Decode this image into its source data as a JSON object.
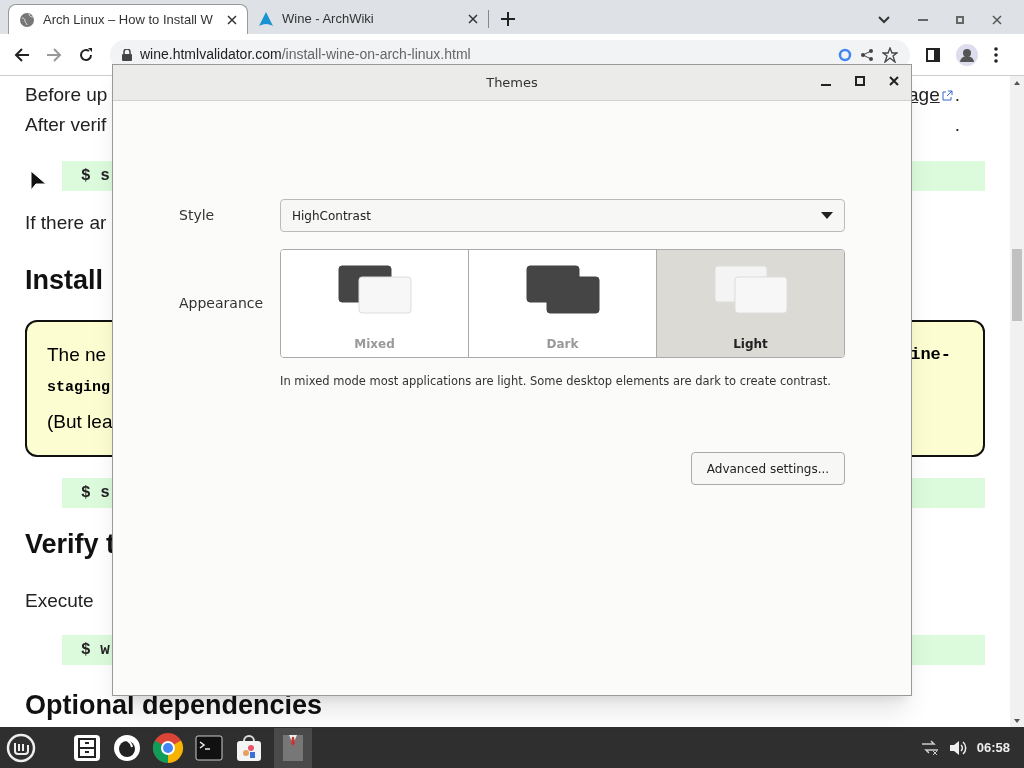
{
  "browser": {
    "tabs": [
      {
        "title": "Arch Linux – How to Install W",
        "selected": true,
        "kind": "globe"
      },
      {
        "title": "Wine - ArchWiki",
        "selected": false,
        "kind": "arch"
      }
    ],
    "url": {
      "host": "wine.htmlvalidator.com",
      "path": "/install-wine-on-arch-linux.html"
    }
  },
  "page": {
    "blocks": [
      {
        "kind": "text",
        "left": "Before up",
        "link": "age",
        "right": "."
      },
      {
        "kind": "text",
        "left": "After verif",
        "right": "."
      },
      {
        "kind": "code",
        "left": "$ s"
      },
      {
        "kind": "text",
        "left": "If there ar"
      },
      {
        "kind": "heading",
        "left": "Install"
      },
      {
        "kind": "note",
        "lines": [
          {
            "left": "The ne",
            "right": "ine-"
          },
          {
            "left": "staging",
            "mono": true
          },
          {
            "left": "(But lea"
          }
        ]
      },
      {
        "kind": "code",
        "left": "$ s"
      },
      {
        "kind": "heading",
        "left": "Verify t"
      },
      {
        "kind": "text",
        "left": "Execute"
      },
      {
        "kind": "code",
        "left": "$ w"
      },
      {
        "kind": "heading",
        "left": "Optional dependencies"
      }
    ]
  },
  "dialog": {
    "title": "Themes",
    "style": {
      "label": "Style",
      "value": "HighContrast"
    },
    "appearance": {
      "label": "Appearance",
      "options": [
        {
          "label": "Mixed",
          "kind": "mixed",
          "selected": false
        },
        {
          "label": "Dark",
          "kind": "dark",
          "selected": false
        },
        {
          "label": "Light",
          "kind": "light",
          "selected": true
        }
      ]
    },
    "description": "In mixed mode most applications are light. Some desktop elements are dark to create contrast.",
    "button": "Advanced settings..."
  },
  "taskbar": {
    "clock": "06:58"
  }
}
